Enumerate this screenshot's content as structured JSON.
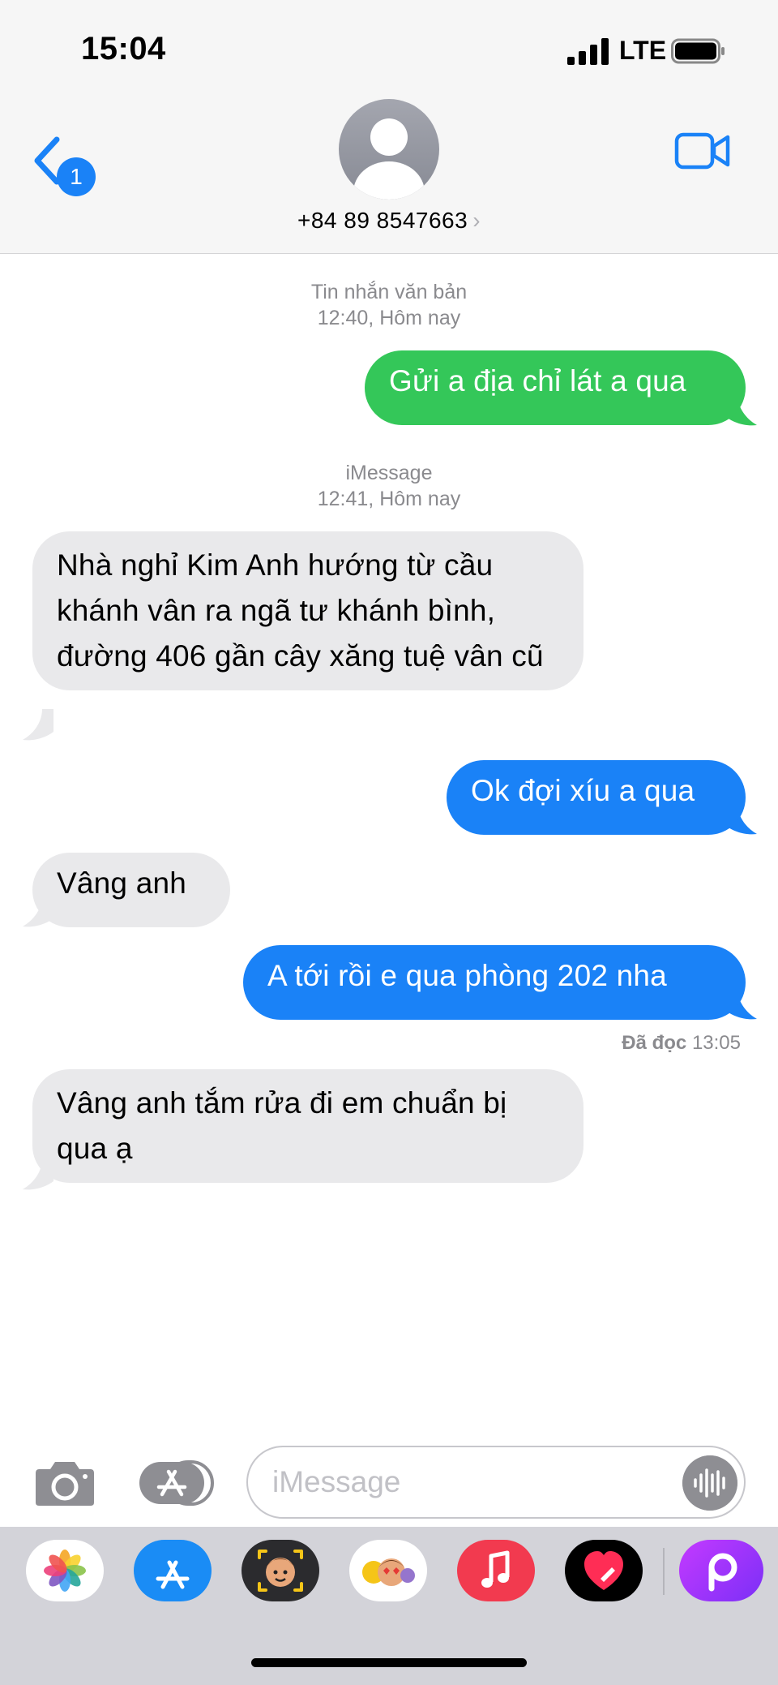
{
  "status_bar": {
    "time": "15:04",
    "network": "LTE"
  },
  "header": {
    "back_badge": "1",
    "contact_phone": "+84 89 8547663",
    "details_chevron": "›"
  },
  "conversation": {
    "sections": [
      {
        "service": "Tin nhắn văn bản",
        "time": "12:40, Hôm nay"
      },
      {
        "service": "iMessage",
        "time": "12:41, Hôm nay"
      }
    ],
    "messages": [
      {
        "direction": "outgoing",
        "type": "sms",
        "text": "Gửi a địa chỉ lát a qua"
      },
      {
        "direction": "incoming",
        "type": "imessage",
        "text": "Nhà nghỉ Kim Anh hướng từ cầu khánh vân ra ngã tư khánh bình, đường 406 gần cây xăng tuệ vân cũ"
      },
      {
        "direction": "outgoing",
        "type": "imessage",
        "text": "Ok đợi xíu a qua"
      },
      {
        "direction": "incoming",
        "type": "imessage",
        "text": "Vâng anh"
      },
      {
        "direction": "outgoing",
        "type": "imessage",
        "text": "A tới rồi e qua phòng 202 nha"
      },
      {
        "direction": "incoming",
        "type": "imessage",
        "text": "Vâng anh tắm rửa đi em chuẩn bị qua ạ"
      }
    ],
    "read_receipt": {
      "label": "Đã đọc",
      "time": "13:05"
    }
  },
  "compose": {
    "placeholder": "iMessage"
  },
  "app_drawer": {
    "apps": [
      "photos-icon",
      "app-store-icon",
      "memoji-icon",
      "animoji-icon",
      "music-icon",
      "digital-touch-icon",
      "picsart-icon"
    ]
  },
  "colors": {
    "imessage_blue": "#1a82f7",
    "sms_green": "#34c759",
    "incoming_gray": "#e9e9eb",
    "header_bg": "#f6f6f6",
    "drawer_bg": "#d3d3d9"
  }
}
